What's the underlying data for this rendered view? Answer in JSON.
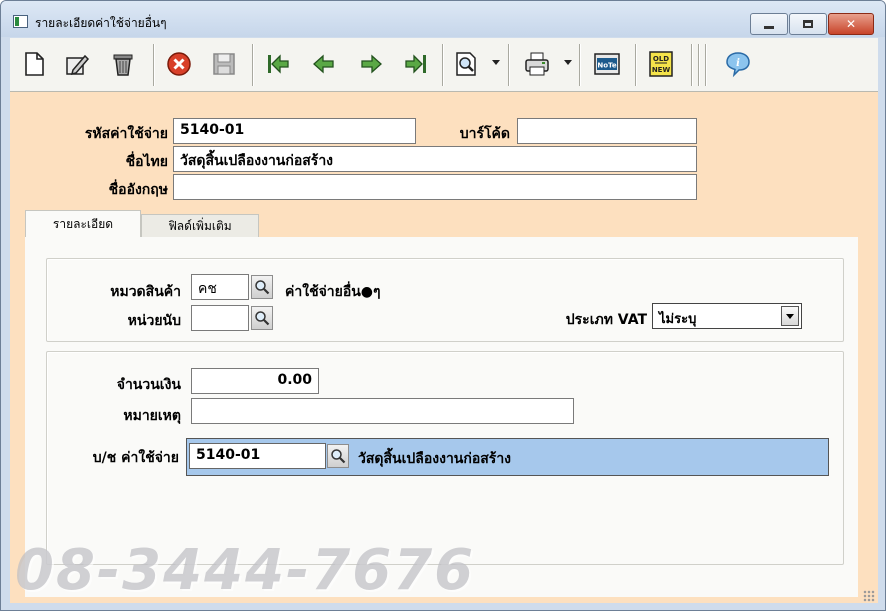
{
  "window": {
    "title": "รายละเอียดค่าใช้จ่ายอื่นๆ"
  },
  "toolbar": {
    "items": [
      "new-document-icon",
      "edit-icon",
      "delete-trash-icon",
      "cancel-icon",
      "save-disk-icon",
      "first-record-icon",
      "previous-record-icon",
      "next-record-icon",
      "last-record-icon",
      "search-preview-icon",
      "print-icon",
      "note-icon",
      "old-new-icon",
      "info-icon"
    ]
  },
  "header": {
    "code_label": "รหัสค่าใช้จ่าย",
    "code_value": "5140-01",
    "barcode_label": "บาร์โค้ด",
    "barcode_value": "",
    "thai_name_label": "ชื่อไทย",
    "thai_name_value": "วัสดุสิ้นเปลืองงานก่อสร้าง",
    "english_name_label": "ชื่ออังกฤษ",
    "english_name_value": ""
  },
  "tabs": [
    {
      "label": "รายละเอียด",
      "active": true
    },
    {
      "label": "ฟิลด์เพิ่มเติม",
      "active": false
    }
  ],
  "details": {
    "category_label": "หมวดสินค้า",
    "category_value": "คช",
    "category_desc": "ค่าใช้จ่ายอื่น●ๆ",
    "unit_label": "หน่วยนับ",
    "unit_value": "",
    "vat_label": "ประเภท VAT",
    "vat_value": "ไม่ระบุ",
    "amount_label": "จำนวนเงิน",
    "amount_value": "0.00",
    "remark_label": "หมายเหตุ",
    "remark_value": "",
    "account_label": "บ/ช ค่าใช้จ่าย",
    "account_value": "5140-01",
    "account_desc": "วัสดุสิ้นเปลืองงานก่อสร้าง"
  },
  "watermark": "08-3444-7676",
  "colors": {
    "form_bg": "#fde0bf",
    "panel_bg": "#fafaf8",
    "account_highlight": "#a6c8ec",
    "close_button": "#c8442a"
  }
}
